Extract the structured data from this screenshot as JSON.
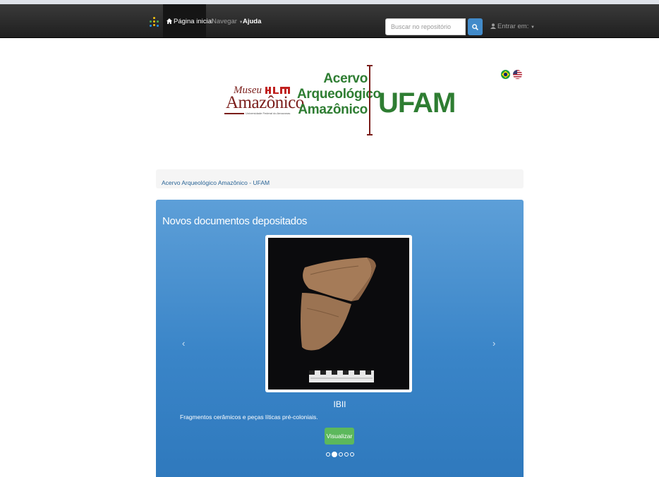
{
  "navbar": {
    "home_label": "Página inicial",
    "browse_label": "Navegar",
    "help_label": "Ajuda",
    "search_placeholder": "Buscar no repositório",
    "login_label": "Entrar em:",
    "icons": [
      "dspace-logo-icon",
      "home-icon",
      "caret-down-icon",
      "search-icon",
      "user-icon"
    ]
  },
  "header": {
    "museu_top": "Museu",
    "museu_main": "Amazônico",
    "museu_sub": "Universidade Federal do Amazonas",
    "acervo_lines": [
      "Acervo",
      "Arqueológico",
      "Amazônico"
    ],
    "ufam": "UFAM",
    "flags": [
      "brazil-flag-icon",
      "usa-flag-icon"
    ]
  },
  "breadcrumb": {
    "item": "Acervo Arqueológico Amazônico - UFAM"
  },
  "carousel": {
    "title": "Novos documentos depositados",
    "prev_glyph": "‹",
    "next_glyph": "›",
    "slide_title": "IBII",
    "slide_description": "Fragmentos cerâmicos e peças líticas pré-coloniais.",
    "view_label": "Visualizar",
    "slide_count": 5,
    "active_index": 1
  },
  "colors": {
    "navbar": "#222222",
    "panel_blue": "#3a85c8",
    "ufam_green": "#2e7d32",
    "museu_red": "#7a1d1a",
    "button_green": "#5cb85c"
  }
}
